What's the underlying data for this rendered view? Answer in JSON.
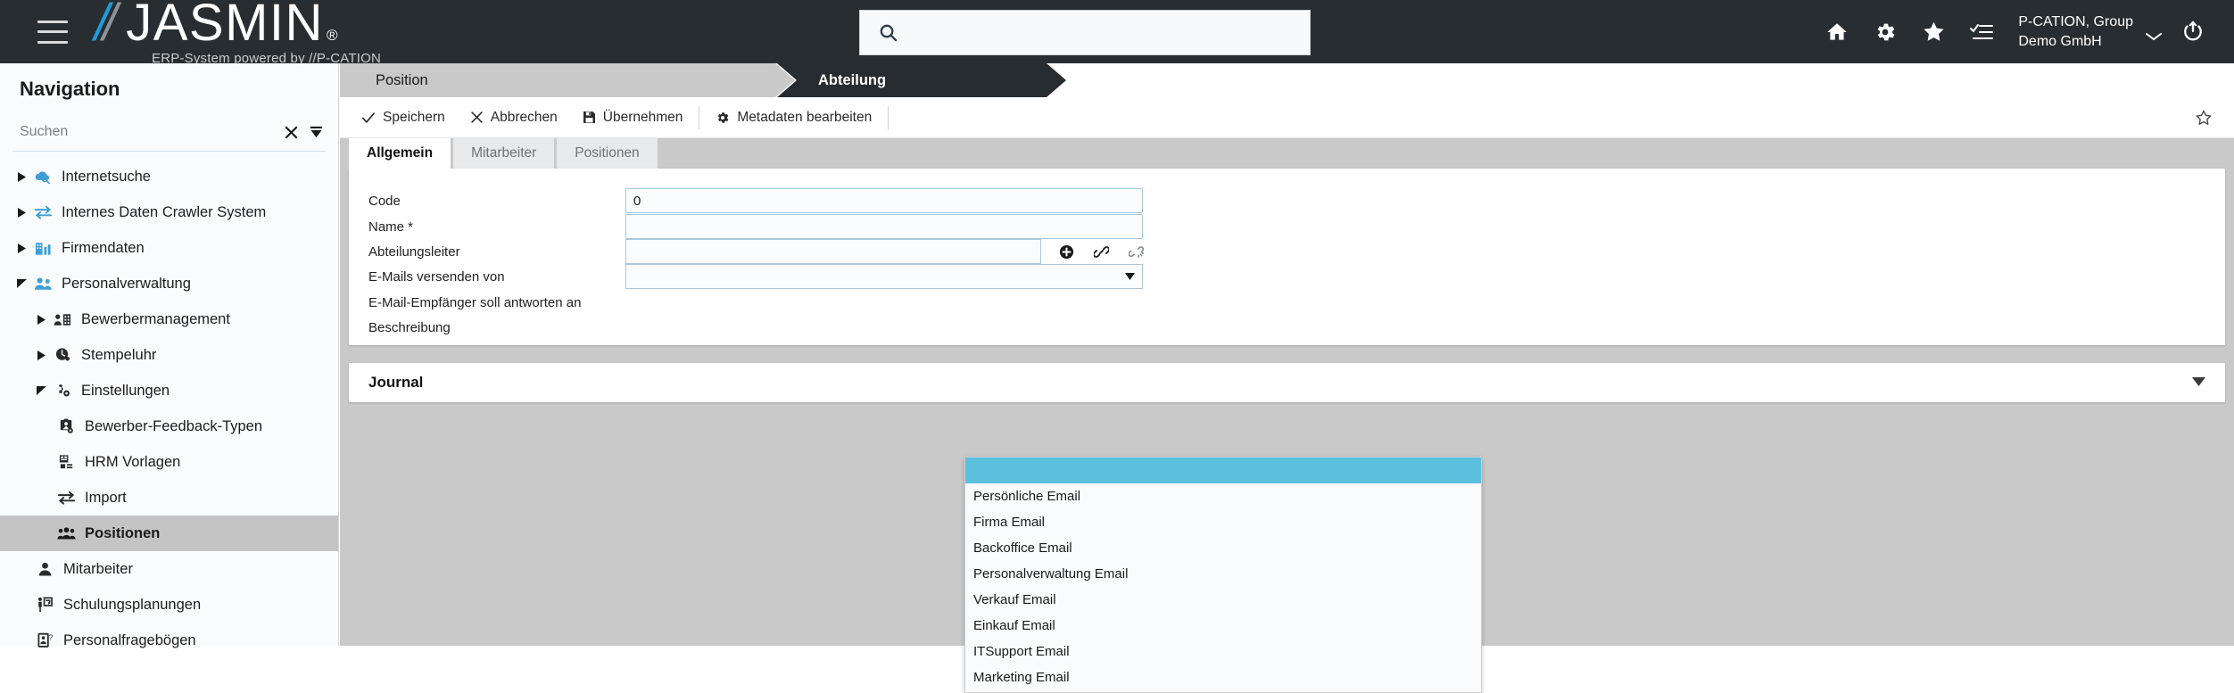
{
  "app": {
    "logo_slashes": "//",
    "logo_name": "JASMIN",
    "logo_reg": "®",
    "logo_tagline": "ERP-System powered by //P-CATION"
  },
  "header": {
    "menu_icon": "hamburger-icon",
    "search": {
      "value": "",
      "placeholder": "",
      "icon": "search-icon"
    },
    "icons": [
      {
        "name": "home-icon",
        "label": "Home"
      },
      {
        "name": "gear-icon",
        "label": "Einstellungen"
      },
      {
        "name": "star-icon",
        "label": "Favoriten"
      },
      {
        "name": "checklist-icon",
        "label": "Aufgaben"
      }
    ],
    "user": {
      "line1": "P-CATION, Group",
      "line2": "Demo GmbH",
      "chevron": "chevron-down-icon"
    },
    "power_icon": "power-logout-icon"
  },
  "sidebar": {
    "title": "Navigation",
    "search": {
      "value": "",
      "placeholder": "Suchen"
    },
    "clear_icon": "close-x-icon",
    "collapse_icon": "collapse-all-icon",
    "items": [
      {
        "label": "Internetsuche",
        "level": 0,
        "arrow": "collapsed",
        "icon": "cloud-search-icon",
        "icon_color": "#3d9fd6",
        "selected": false
      },
      {
        "label": "Internes Daten Crawler System",
        "level": 0,
        "arrow": "collapsed",
        "icon": "exchange-arrows-icon",
        "icon_color": "#3d9fd6",
        "selected": false
      },
      {
        "label": "Firmendaten",
        "level": 0,
        "arrow": "collapsed",
        "icon": "building-chart-icon",
        "icon_color": "#3d9fd6",
        "selected": false
      },
      {
        "label": "Personalverwaltung",
        "level": 0,
        "arrow": "expanded",
        "icon": "people-icon",
        "icon_color": "#3d9fd6",
        "selected": false
      },
      {
        "label": "Bewerbermanagement",
        "level": 1,
        "arrow": "collapsed",
        "icon": "applicant-icon",
        "icon_color": "#2b2b2b",
        "selected": false
      },
      {
        "label": "Stempeluhr",
        "level": 1,
        "arrow": "collapsed",
        "icon": "time-clock-icon",
        "icon_color": "#2b2b2b",
        "selected": false
      },
      {
        "label": "Einstellungen",
        "level": 1,
        "arrow": "expanded",
        "icon": "gears-icon",
        "icon_color": "#2b2b2b",
        "selected": false
      },
      {
        "label": "Bewerber-Feedback-Typen",
        "level": 2,
        "arrow": "none",
        "icon": "feedback-clipboard-icon",
        "icon_color": "#2b2b2b",
        "selected": false
      },
      {
        "label": "HRM Vorlagen",
        "level": 2,
        "arrow": "none",
        "icon": "template-icon",
        "icon_color": "#2b2b2b",
        "selected": false
      },
      {
        "label": "Import",
        "level": 2,
        "arrow": "none",
        "icon": "import-arrows-icon",
        "icon_color": "#2b2b2b",
        "selected": false
      },
      {
        "label": "Positionen",
        "level": 2,
        "arrow": "none",
        "icon": "people-group-icon",
        "icon_color": "#2b2b2b",
        "selected": true
      },
      {
        "label": "Mitarbeiter",
        "level": 1,
        "arrow": "none",
        "icon": "person-icon",
        "icon_color": "#2b2b2b",
        "selected": false
      },
      {
        "label": "Schulungsplanungen",
        "level": 1,
        "arrow": "none",
        "icon": "training-icon",
        "icon_color": "#2b2b2b",
        "selected": false
      },
      {
        "label": "Personalfragebögen",
        "level": 1,
        "arrow": "none",
        "icon": "questionnaire-icon",
        "icon_color": "#2b2b2b",
        "selected": false
      }
    ]
  },
  "breadcrumb": {
    "items": [
      {
        "label": "Position",
        "active": false
      },
      {
        "label": "Abteilung",
        "active": true
      }
    ]
  },
  "toolbar": {
    "save_label": "Speichern",
    "cancel_label": "Abbrechen",
    "apply_label": "Übernehmen",
    "metadata_label": "Metadaten bearbeiten",
    "favorite_icon": "star-outline-icon"
  },
  "tabs": [
    {
      "label": "Allgemein",
      "active": true
    },
    {
      "label": "Mitarbeiter",
      "active": false
    },
    {
      "label": "Positionen",
      "active": false
    }
  ],
  "form": {
    "code": {
      "label": "Code",
      "value": "0"
    },
    "name": {
      "label": "Name *",
      "value": ""
    },
    "abteilungsleiter": {
      "label": "Abteilungsleiter",
      "value": "",
      "icons": [
        {
          "name": "add-circle-icon"
        },
        {
          "name": "link-icon"
        },
        {
          "name": "unlink-icon"
        }
      ]
    },
    "emails_from": {
      "label": "E-Mails versenden von",
      "value": "",
      "arrow_icon": "dropdown-caret-icon"
    },
    "reply_to": {
      "label": "E-Mail-Empfänger soll antworten an"
    },
    "description": {
      "label": "Beschreibung"
    }
  },
  "dropdown": {
    "open": true,
    "highlight_color": "#5bc0de",
    "options": [
      {
        "label": "",
        "selected": true
      },
      {
        "label": "Persönliche Email",
        "selected": false
      },
      {
        "label": "Firma Email",
        "selected": false
      },
      {
        "label": "Backoffice Email",
        "selected": false
      },
      {
        "label": "Personalverwaltung Email",
        "selected": false
      },
      {
        "label": "Verkauf Email",
        "selected": false
      },
      {
        "label": "Einkauf Email",
        "selected": false
      },
      {
        "label": "ITSupport Email",
        "selected": false
      },
      {
        "label": "Marketing Email",
        "selected": false
      }
    ]
  },
  "journal": {
    "title": "Journal",
    "expand_icon": "caret-down-icon"
  },
  "colors": {
    "header_bg": "#282d31",
    "accent_blue": "#1e9ddb",
    "content_bg": "#c9c9c9",
    "breadcrumb_active": "#272c30",
    "breadcrumb_inactive": "#c9c9c9",
    "input_border": "#a9c7dc"
  }
}
